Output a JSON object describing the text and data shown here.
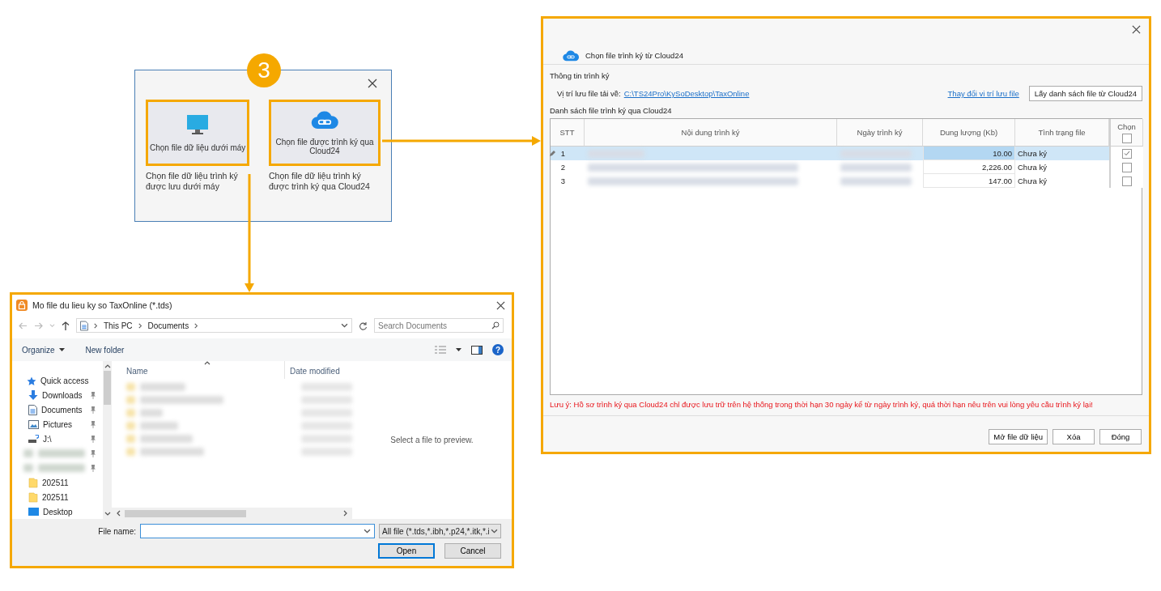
{
  "step_badge": "3",
  "chooser": {
    "options": [
      {
        "kind": "computer",
        "label": "Chọn file dữ liệu dưới máy",
        "description": "Chọn file dữ liệu trình ký được lưu dưới máy",
        "highlighted": true
      },
      {
        "kind": "cloud",
        "label": "Chọn file được trình ký qua Cloud24",
        "description": "Chọn file dữ liệu trình ký được trình ký qua Cloud24",
        "highlighted": true
      }
    ]
  },
  "file_dialog": {
    "title": "Mo file du lieu ky so TaxOnline (*.tds)",
    "breadcrumb": [
      "This PC",
      "Documents"
    ],
    "search": {
      "placeholder": "Search Documents"
    },
    "toolbar": [
      "Organize",
      "New folder"
    ],
    "help": "?",
    "nav_items": [
      {
        "kind": "quick",
        "label": "Quick access",
        "pinned": false
      },
      {
        "kind": "download",
        "label": "Downloads",
        "pinned": true
      },
      {
        "kind": "document",
        "label": "Documents",
        "pinned": true
      },
      {
        "kind": "picture",
        "label": "Pictures",
        "pinned": true
      },
      {
        "kind": "drive",
        "label": "J:\\",
        "pinned": true
      },
      {
        "kind": "blurred",
        "pinned": true
      },
      {
        "kind": "blurred",
        "pinned": true
      },
      {
        "kind": "folder",
        "label": "202511",
        "pinned": false
      },
      {
        "kind": "folder",
        "label": "202511",
        "pinned": false
      },
      {
        "kind": "desktop",
        "label": "Desktop",
        "pinned": false
      }
    ],
    "columns": [
      "Name",
      "Date modified"
    ],
    "preview_text": "Select a file to preview.",
    "file_name_label": "File name:",
    "filter": "All file (*.tds,*.ibh,*.p24,*.itk,*.i",
    "buttons": [
      {
        "label": "Open",
        "default": true
      },
      {
        "label": "Cancel",
        "default": false
      }
    ]
  },
  "cloud_dialog": {
    "title": "Chọn file trình ký từ Cloud24",
    "section": "Thông tin trình ký",
    "path_label": "Vị trí lưu file tải về:",
    "path": "C:\\TS24Pro\\KySoDesktop\\TaxOnline",
    "change_link": "Thay đổi vị trí lưu file",
    "fetch_button": "Lấy danh sách file từ Cloud24",
    "list_label": "Danh sách file trình ký qua Cloud24",
    "columns": [
      "STT",
      "Nội dung trình ký",
      "Ngày trình ký",
      "Dung lượng (Kb)",
      "Tình trạng file",
      "Chọn"
    ],
    "select_all_checked": false,
    "rows": [
      {
        "stt": "1",
        "size": "10.00",
        "status": "Chưa ký",
        "checked": true,
        "selected": true,
        "editing": true
      },
      {
        "stt": "2",
        "size": "2,226.00",
        "status": "Chưa ký",
        "checked": false,
        "selected": false,
        "editing": false
      },
      {
        "stt": "3",
        "size": "147.00",
        "status": "Chưa ký",
        "checked": false,
        "selected": false,
        "editing": false
      }
    ],
    "note": "Lưu ý: Hồ sơ trình ký qua Cloud24 chỉ được lưu trữ trên hệ thống trong thời hạn 30 ngày kể từ ngày trình ký, quá thời hạn nêu trên vui lòng yêu cầu trình ký lại!",
    "buttons": [
      "Mở file dữ liệu",
      "Xóa",
      "Đóng"
    ]
  }
}
